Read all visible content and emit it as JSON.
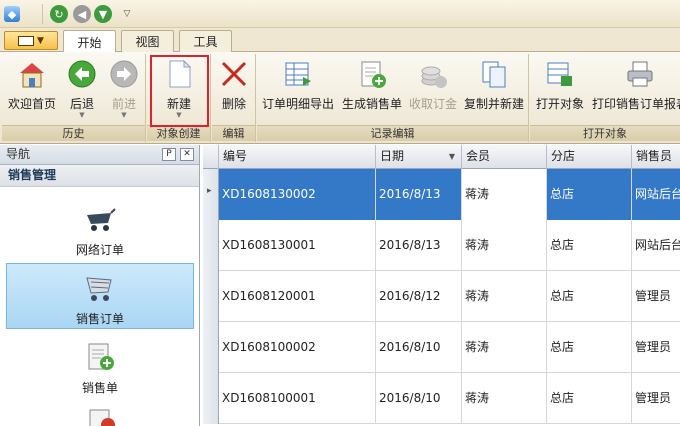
{
  "titlebar": {
    "icons": [
      "app-gem-icon",
      "refresh-icon",
      "back-circle-icon",
      "down-circle-icon",
      "dropdown-icon"
    ]
  },
  "tabs": [
    {
      "label": "开始",
      "active": true
    },
    {
      "label": "视图",
      "active": false
    },
    {
      "label": "工具",
      "active": false
    }
  ],
  "ribbon": {
    "groups": [
      {
        "label": "历史",
        "buttons": [
          {
            "label": "欢迎首页"
          },
          {
            "label": "后退"
          },
          {
            "label": "前进",
            "disabled": true
          }
        ]
      },
      {
        "label": "对象创建",
        "buttons": [
          {
            "label": "新建"
          }
        ]
      },
      {
        "label": "编辑",
        "buttons": [
          {
            "label": "删除"
          }
        ]
      },
      {
        "label": "记录编辑",
        "buttons": [
          {
            "label": "订单明细导出"
          },
          {
            "label": "生成销售单"
          },
          {
            "label": "收取订金",
            "disabled": true
          },
          {
            "label": "复制并新建"
          }
        ]
      },
      {
        "label": "打开对象",
        "buttons": [
          {
            "label": "打开对象"
          },
          {
            "label": "打印销售订单报表"
          }
        ]
      }
    ]
  },
  "sidebar": {
    "title": "导航",
    "pin": "P",
    "close": "✕",
    "group": "销售管理",
    "items": [
      {
        "label": "网络订单"
      },
      {
        "label": "销售订单",
        "selected": true
      },
      {
        "label": "销售单"
      }
    ]
  },
  "grid": {
    "columns": [
      "编号",
      "日期",
      "会员",
      "分店",
      "销售员"
    ],
    "rows": [
      [
        "XD1608130002",
        "2016/8/13",
        "蒋涛",
        "总店",
        "网站后台"
      ],
      [
        "XD1608130001",
        "2016/8/13",
        "蒋涛",
        "总店",
        "网站后台"
      ],
      [
        "XD1608120001",
        "2016/8/12",
        "蒋涛",
        "总店",
        "管理员"
      ],
      [
        "XD1608100002",
        "2016/8/10",
        "蒋涛",
        "总店",
        "管理员"
      ],
      [
        "XD1608100001",
        "2016/8/10",
        "蒋涛",
        "总店",
        "管理员"
      ]
    ],
    "selected_row": 0,
    "sort_column": 1
  }
}
